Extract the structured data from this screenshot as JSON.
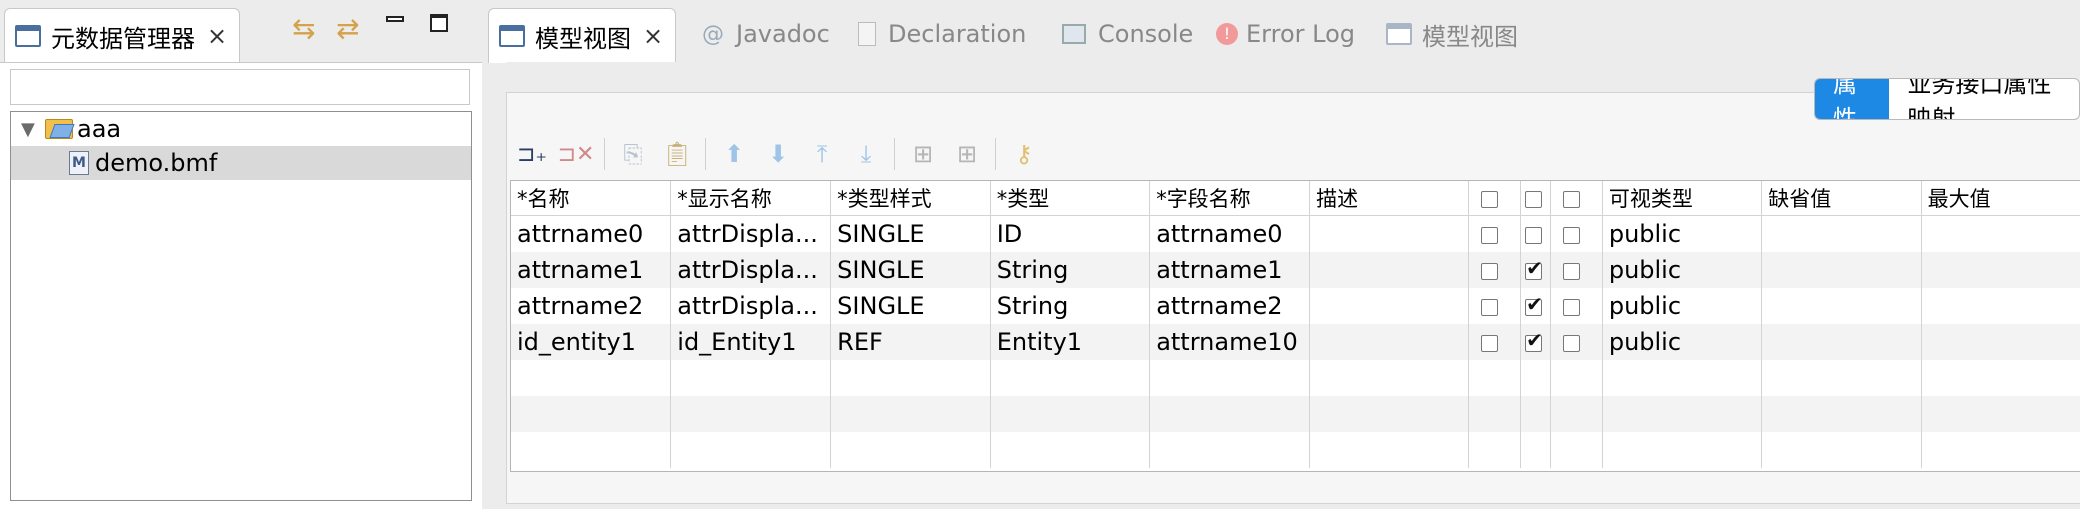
{
  "left_view": {
    "tab_title": "元数据管理器",
    "filter_value": "",
    "tree": [
      {
        "label": "aaa",
        "icon": "folder-open-icon",
        "expanded": true,
        "selected": false
      },
      {
        "label": "demo.bmf",
        "icon": "model-file-icon",
        "selected": true
      }
    ]
  },
  "right_tabs": [
    {
      "label": "模型视图",
      "active": true
    },
    {
      "label": "Javadoc",
      "active": false,
      "icon": "at-icon"
    },
    {
      "label": "Declaration",
      "active": false,
      "icon": "declaration-icon"
    },
    {
      "label": "Console",
      "active": false,
      "icon": "console-icon"
    },
    {
      "label": "Error Log",
      "active": false,
      "icon": "error-log-icon"
    },
    {
      "label": "模型视图",
      "active": false,
      "icon": "view-icon"
    }
  ],
  "segments": [
    {
      "label": "属性",
      "active": true
    },
    {
      "label": "业务接口属性映射",
      "active": false
    }
  ],
  "toolbar": [
    "add-row-icon",
    "delete-row-icon",
    "copy-icon",
    "paste-icon",
    "move-up-icon",
    "move-down-icon",
    "move-top-icon",
    "move-bottom-icon",
    "grid-icon",
    "grid-alt-icon",
    "key-icon"
  ],
  "table": {
    "columns": [
      "*名称",
      "*显示名称",
      "*类型样式",
      "*类型",
      "*字段名称",
      "描述",
      "",
      "",
      "",
      "可视类型",
      "缺省值",
      "最大值"
    ],
    "rows": [
      {
        "name": "attrname0",
        "display": "attrDispla...",
        "style": "SINGLE",
        "type": "ID",
        "field": "attrname0",
        "desc": "",
        "c1": false,
        "c2": false,
        "c3": false,
        "visibility": "public",
        "default": "",
        "max": ""
      },
      {
        "name": "attrname1",
        "display": "attrDispla...",
        "style": "SINGLE",
        "type": "String",
        "field": "attrname1",
        "desc": "",
        "c1": false,
        "c2": true,
        "c3": false,
        "visibility": "public",
        "default": "",
        "max": ""
      },
      {
        "name": "attrname2",
        "display": "attrDispla...",
        "style": "SINGLE",
        "type": "String",
        "field": "attrname2",
        "desc": "",
        "c1": false,
        "c2": true,
        "c3": false,
        "visibility": "public",
        "default": "",
        "max": ""
      },
      {
        "name": "id_entity1",
        "display": "id_Entity1",
        "style": "REF",
        "type": "Entity1",
        "field": "attrname10",
        "desc": "",
        "c1": false,
        "c2": true,
        "c3": false,
        "visibility": "public",
        "default": "",
        "max": ""
      }
    ]
  }
}
